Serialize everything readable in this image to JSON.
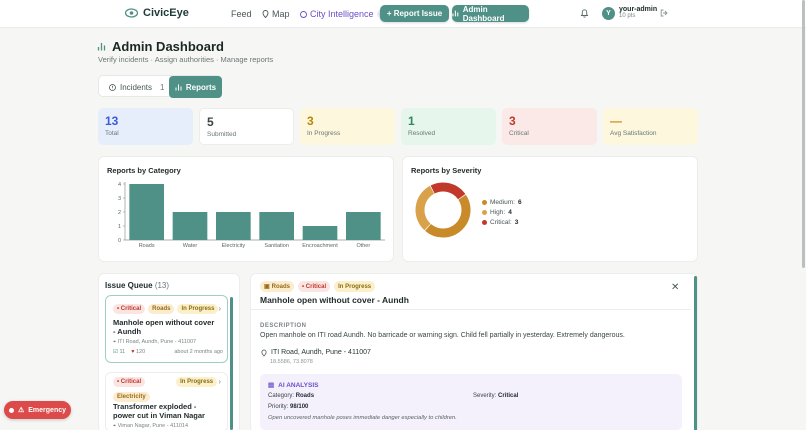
{
  "header": {
    "brand": "CivicEye",
    "nav_feed": "Feed",
    "nav_map": "Map",
    "nav_city": "City Intelligence",
    "nav_city_badge": "AI",
    "report_issue": "+ Report Issue",
    "admin_dashboard": "Admin Dashboard",
    "avatar_initial": "Y",
    "user_name": "your-admin",
    "user_points": "10 pts"
  },
  "page": {
    "title": "Admin Dashboard",
    "subtitle": "Verify incidents · Assign authorities · Manage reports"
  },
  "tabs": {
    "incidents_label": "Incidents",
    "incidents_count": "1",
    "reports_label": "Reports"
  },
  "stats": [
    {
      "value": "13",
      "label": "Total",
      "color": "#3b5bdb",
      "bg": "#e7eefb"
    },
    {
      "value": "5",
      "label": "Submitted",
      "color": "#3a4646",
      "bg": "#ffffff"
    },
    {
      "value": "3",
      "label": "In Progress",
      "color": "#b8860b",
      "bg": "#fdf7dd"
    },
    {
      "value": "1",
      "label": "Resolved",
      "color": "#2e8b57",
      "bg": "#e7f6ec"
    },
    {
      "value": "3",
      "label": "Critical",
      "color": "#c0392b",
      "bg": "#fbe9e7"
    },
    {
      "value": "—",
      "label": "Avg Satisfaction",
      "color": "#d08b1a",
      "bg": "#fdf7dd"
    }
  ],
  "chart_data": [
    {
      "type": "bar",
      "title": "Reports by Category",
      "categories": [
        "Roads",
        "Water",
        "Electricity",
        "Sanitation",
        "Encroachment",
        "Other"
      ],
      "values": [
        4,
        2,
        2,
        2,
        1,
        2
      ],
      "ylim": [
        0,
        4
      ],
      "yticks": [
        "0",
        "1",
        "2",
        "3",
        "4"
      ],
      "color": "#4f9186"
    },
    {
      "type": "pie",
      "title": "Reports by Severity",
      "legend": "right",
      "series": [
        {
          "name": "Medium",
          "value": 6,
          "color": "#c98a2a"
        },
        {
          "name": "High",
          "value": 4,
          "color": "#d9a24a"
        },
        {
          "name": "Critical",
          "value": 3,
          "color": "#c0392b"
        }
      ]
    }
  ],
  "queue": {
    "title": "Issue Queue",
    "count": "(13)",
    "items": [
      {
        "badges": [
          "• Critical",
          "Roads",
          "In Progress"
        ],
        "title": "Manhole open without cover - Aundh",
        "address": "ITI Road, Aundh, Pune - 411007",
        "votes": "11",
        "views": "120",
        "time": "about 2 months ago"
      },
      {
        "badges": [
          "• Critical",
          "In Progress",
          "Electricity"
        ],
        "title": "Transformer exploded - power cut in Viman Nagar",
        "address": "Viman Nagar, Pune - 411014"
      }
    ]
  },
  "detail": {
    "badge_category": "Roads",
    "badge_severity": "• Critical",
    "badge_status": "In Progress",
    "title": "Manhole open without cover - Aundh",
    "description_label": "DESCRIPTION",
    "description": "Open manhole on ITI road Aundh. No barricade or warning sign. Child fell partially in yesterday. Extremely dangerous.",
    "location": "ITI Road, Aundh, Pune - 411007",
    "coords": "18.5586, 73.8078",
    "ai": {
      "heading": "AI ANALYSIS",
      "category_label": "Category:",
      "category": "Roads",
      "severity_label": "Severity:",
      "severity": "Critical",
      "priority_label": "Priority:",
      "priority": "98/100",
      "note": "Open uncovered manhole poses immediate danger especially to children."
    }
  },
  "emergency": "Emergency"
}
